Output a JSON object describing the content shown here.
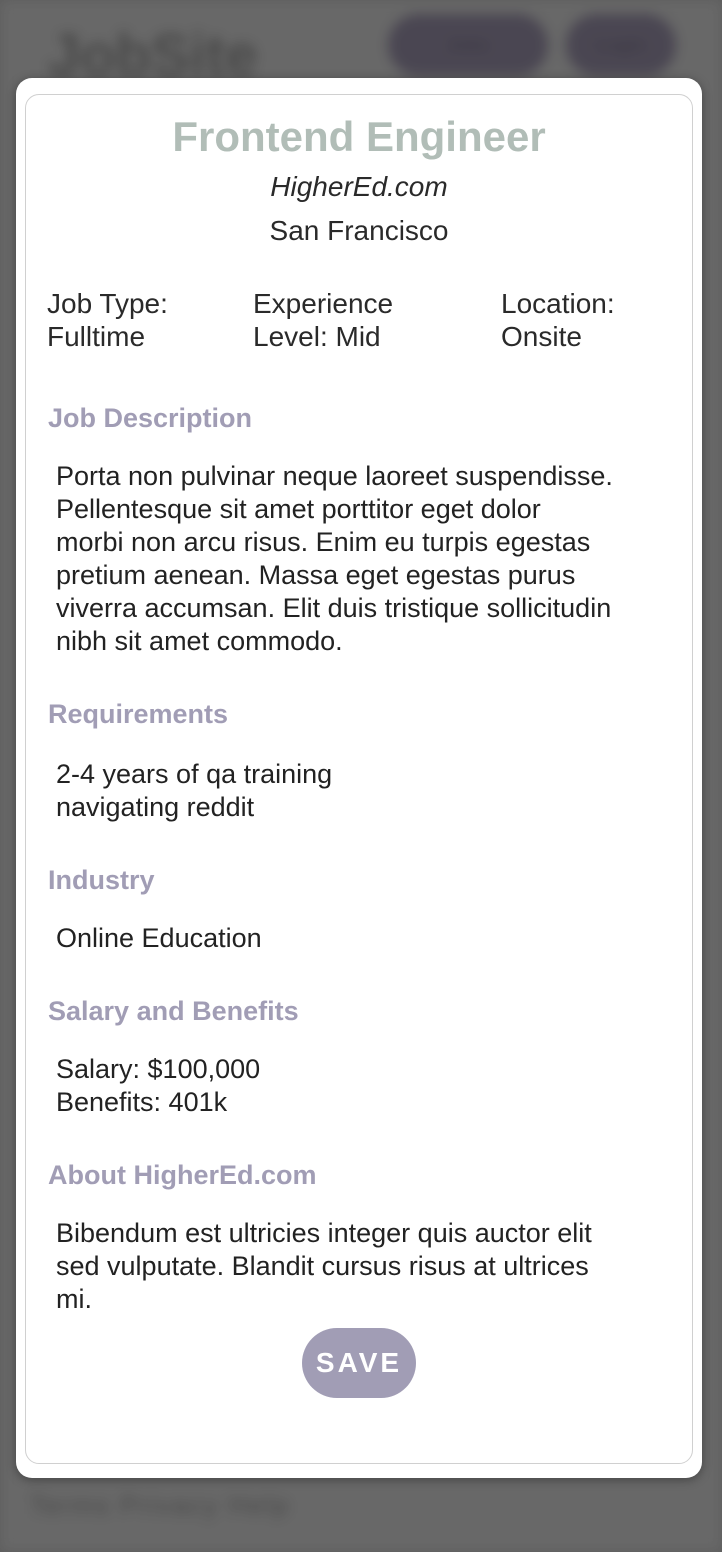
{
  "background": {
    "logo": "JobSite",
    "nav": [
      "Jobs",
      "Login"
    ],
    "footer": "Terms Privacy Help"
  },
  "job": {
    "title": "Frontend Engineer",
    "company": "HigherEd.com",
    "city": "San Francisco",
    "meta": {
      "job_type": [
        "Job Type:",
        "Fulltime"
      ],
      "experience": [
        "Experience",
        "Level: Mid"
      ],
      "location": [
        "Location:",
        "Onsite"
      ]
    }
  },
  "sections": {
    "description": {
      "title": "Job Description",
      "lines": [
        "Porta non pulvinar neque laoreet suspendisse.",
        "Pellentesque sit amet porttitor eget dolor",
        "morbi non arcu risus. Enim eu turpis egestas",
        "pretium aenean. Massa eget egestas purus",
        "viverra accumsan. Elit duis tristique sollicitudin",
        "nibh sit amet commodo."
      ]
    },
    "requirements": {
      "title": "Requirements",
      "lines": [
        "2-4 years of qa training",
        "navigating reddit"
      ]
    },
    "industry": {
      "title": "Industry",
      "lines": [
        "Online Education"
      ]
    },
    "salary": {
      "title": "Salary and Benefits",
      "lines": [
        "Salary: $100,000",
        "Benefits: 401k"
      ]
    },
    "about": {
      "title": "About HigherEd.com",
      "lines": [
        "Bibendum est ultricies integer quis auctor elit",
        "sed vulputate. Blandit cursus risus at ultrices",
        "mi."
      ]
    }
  },
  "actions": {
    "save_label": "SAVE"
  },
  "colors": {
    "title": "#b1bdb7",
    "section_heading": "#a19db5",
    "save_button": "#a19db5"
  }
}
